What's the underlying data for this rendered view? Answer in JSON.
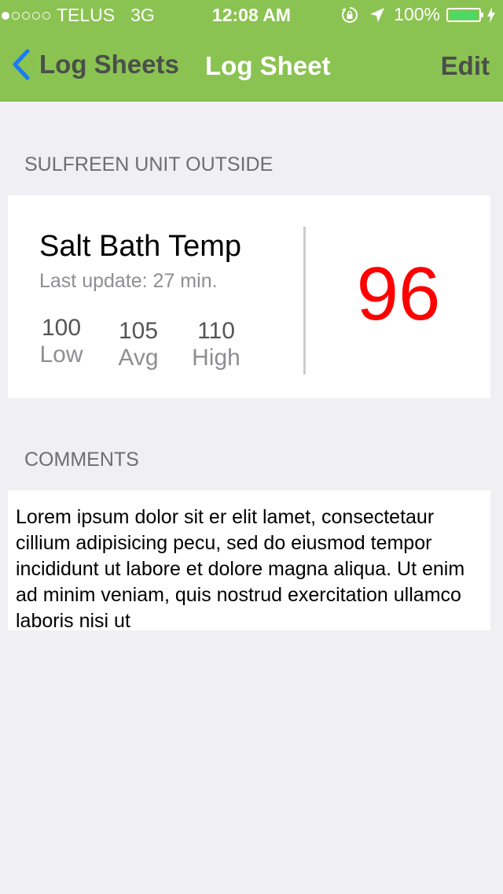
{
  "status_bar": {
    "signal_dots": 5,
    "signal_filled": 1,
    "carrier": "TELUS",
    "network": "3G",
    "time": "12:08 AM",
    "battery": "100%"
  },
  "nav": {
    "back_label": "Log Sheets",
    "title": "Log Sheet",
    "edit_label": "Edit"
  },
  "sections": {
    "unit_header": "SULFREEN UNIT OUTSIDE",
    "comments_header": "COMMENTS"
  },
  "metric": {
    "title": "Salt Bath Temp",
    "last_update": "Last update: 27 min.",
    "low_value": "100",
    "low_label": "Low",
    "avg_value": "105",
    "avg_label": "Avg",
    "high_value": "110",
    "high_label": "High",
    "current_value": "96",
    "current_color": "#ff0000"
  },
  "comments": {
    "text": "Lorem ipsum dolor sit er elit lamet, consectetaur cillium adipisicing pecu, sed do eiusmod tempor incididunt ut labore et dolore magna aliqua. Ut enim ad minim veniam, quis nostrud exercitation ullamco laboris nisi ut"
  },
  "colors": {
    "nav_background": "#8bc352",
    "back_chevron": "#1a7cf2",
    "page_background": "#efeff4"
  }
}
